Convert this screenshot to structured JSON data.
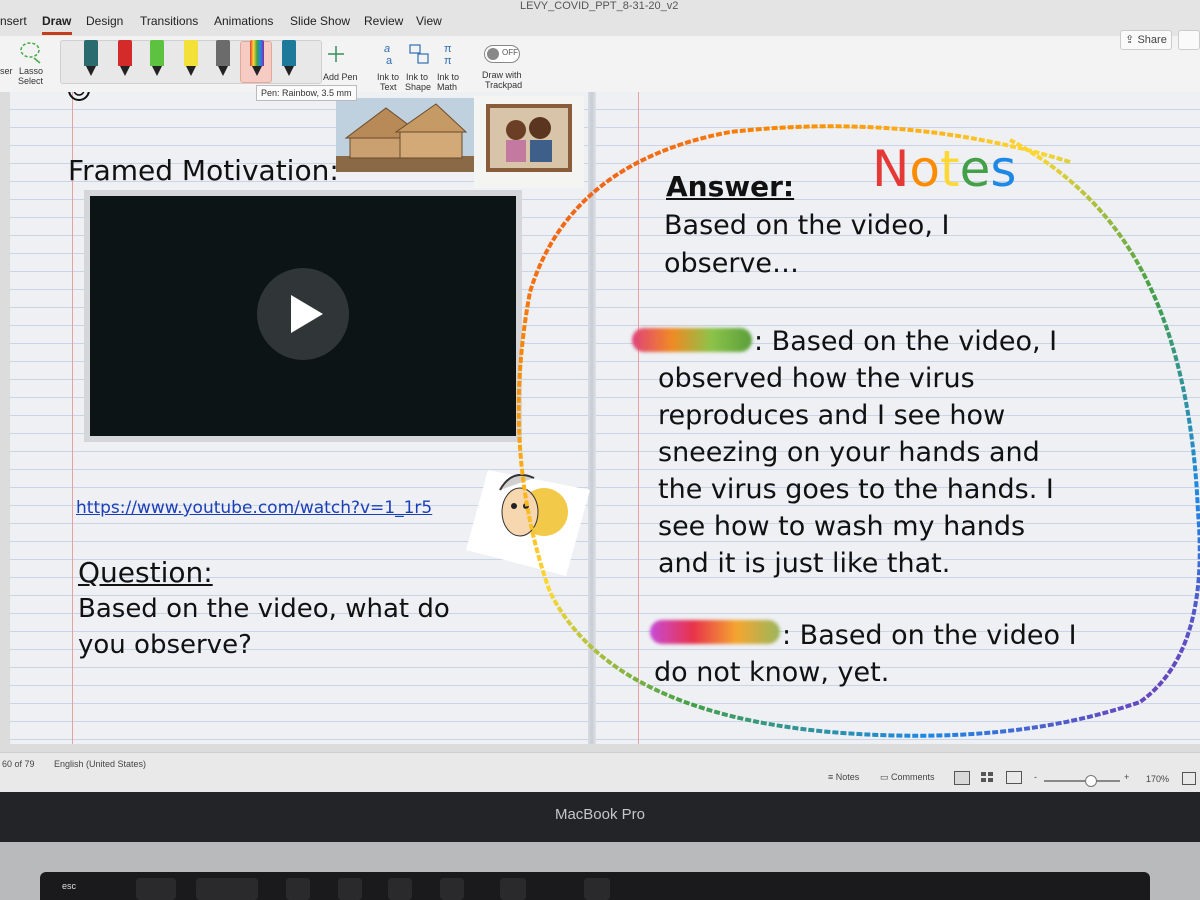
{
  "window": {
    "doc_title": "LEVY_COVID_PPT_8-31-20_v2",
    "share_label": "Share"
  },
  "ribbon_tabs": [
    "nsert",
    "Draw",
    "Design",
    "Transitions",
    "Animations",
    "Slide Show",
    "Review",
    "View"
  ],
  "ribbon": {
    "eraser_label": "ser",
    "lasso_label_1": "Lasso",
    "lasso_label_2": "Select",
    "add_pen_label": "Add Pen",
    "ink_to_text_1": "Ink to",
    "ink_to_text_2": "Text",
    "ink_to_shape_1": "Ink to",
    "ink_to_shape_2": "Shape",
    "ink_to_math_1": "Ink to",
    "ink_to_math_2": "Math",
    "toggle_state": "OFF",
    "trackpad_label_1": "Draw with",
    "trackpad_label_2": "Trackpad",
    "tooltip": "Pen: Rainbow, 3.5 mm",
    "pens": [
      {
        "name": "galaxy-teal-pen",
        "color": "#2a6b70"
      },
      {
        "name": "red-pen",
        "color": "#d42a2a"
      },
      {
        "name": "green-pen",
        "color": "#5cc23f"
      },
      {
        "name": "yellow-highlighter",
        "color": "#f3e13a"
      },
      {
        "name": "gray-pencil",
        "color": "#6b6b6b"
      },
      {
        "name": "rainbow-pen",
        "color": "#3a7bd5"
      },
      {
        "name": "ocean-pen",
        "color": "#1d7a9a"
      }
    ]
  },
  "slide": {
    "heading": "Framed Motivation:",
    "link": "https://www.youtube.com/watch?v=1_1r5",
    "question_label": "Question:",
    "question_line1": "Based on the video, what do",
    "question_line2": "you observe?",
    "notes_title": "Notes",
    "notes_title_colors": [
      "#e53935",
      "#fb8c00",
      "#fdd835",
      "#43a047",
      "#1e88e5",
      "#8e24aa"
    ],
    "answer_label": "Answer:",
    "answer_line1": "Based on the video, I",
    "answer_line2": "observe…",
    "student1_lines": [
      ": Based on the video, I",
      "observed how the virus",
      "reproduces and I see how",
      "sneezing on your hands and",
      "the virus goes to the hands. I",
      "see how to wash my hands",
      "and it is just like that."
    ],
    "student2_lines": [
      ": Based on the video I",
      "do not know, yet."
    ]
  },
  "status": {
    "slide_count": "60 of 79",
    "language": "English (United States)",
    "notes": "Notes",
    "comments": "Comments",
    "zoom_minus": "-",
    "zoom_plus": "+",
    "zoom": "170%"
  },
  "device": {
    "brand": "MacBook Pro",
    "esc": "esc"
  }
}
